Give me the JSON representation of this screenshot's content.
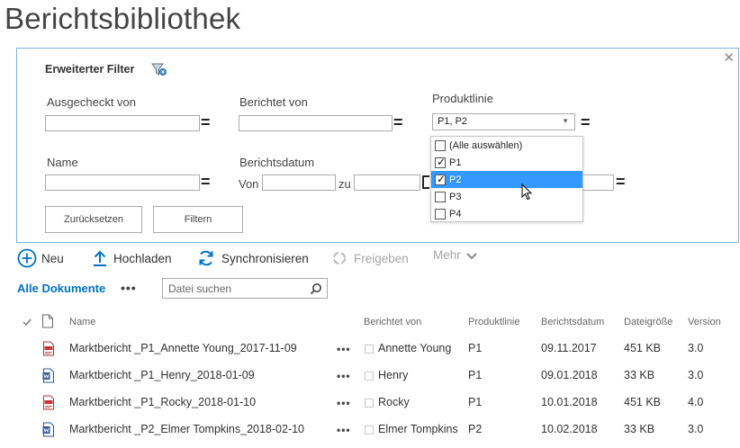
{
  "page": {
    "title": "Berichtsbibliothek"
  },
  "filter": {
    "title": "Erweiterter Filter",
    "labels": {
      "checked_out_by": "Ausgecheckt von",
      "reported_by": "Berichtet von",
      "product_line": "Produktlinie",
      "name": "Name",
      "report_date": "Berichtsdatum",
      "from": "Von",
      "to": "zu"
    },
    "values": {
      "checked_out_by": "",
      "reported_by": "",
      "name": "",
      "date_from": "",
      "date_to": ""
    },
    "equals": "=",
    "product_line_selected": "P1, P2",
    "dropdown_options": [
      {
        "label": "(Alle auswählen)",
        "checked": false,
        "highlighted": false
      },
      {
        "label": "P1",
        "checked": true,
        "highlighted": false
      },
      {
        "label": "P2",
        "checked": true,
        "highlighted": true
      },
      {
        "label": "P3",
        "checked": false,
        "highlighted": false
      },
      {
        "label": "P4",
        "checked": false,
        "highlighted": false
      }
    ],
    "reset_label": "Zurücksetzen",
    "filter_label": "Filtern",
    "close_glyph": "✕",
    "funnel_icon": "funnel-gear-icon"
  },
  "commands": {
    "new": "Neu",
    "upload": "Hochladen",
    "sync": "Synchronisieren",
    "share": "Freigeben",
    "more": "Mehr",
    "more_glyph": "⌄"
  },
  "view": {
    "name": "Alle Dokumente",
    "dots": "•••",
    "search_placeholder": "Datei suchen"
  },
  "table": {
    "columns": {
      "name": "Name",
      "reported_by": "Berichtet von",
      "product_line": "Produktlinie",
      "report_date": "Berichtsdatum",
      "file_size": "Dateigröße",
      "version": "Version"
    },
    "row_dots": "•••",
    "rows": [
      {
        "name": "Marktbericht _P1_Annette Young_2017-11-09",
        "icon": "pdf-file-icon",
        "reported_by": "Annette Young",
        "product_line": "P1",
        "report_date": "09.11.2017",
        "file_size": "451 KB",
        "version": "3.0"
      },
      {
        "name": "Marktbericht _P1_Henry_2018-01-09",
        "icon": "word-file-icon",
        "reported_by": "Henry",
        "product_line": "P1",
        "report_date": "09.01.2018",
        "file_size": "33 KB",
        "version": "3.0"
      },
      {
        "name": "Marktbericht _P1_Rocky_2018-01-10",
        "icon": "pdf-file-icon",
        "reported_by": "Rocky",
        "product_line": "P1",
        "report_date": "10.01.2018",
        "file_size": "451 KB",
        "version": "4.0"
      },
      {
        "name": "Marktbericht _P2_Elmer Tompkins_2018-02-10",
        "icon": "word-file-icon",
        "reported_by": "Elmer Tompkins",
        "product_line": "P2",
        "report_date": "10.02.2018",
        "file_size": "33 KB",
        "version": "3.0"
      }
    ]
  },
  "colors": {
    "accent": "#0072c6",
    "highlight": "#3399ff",
    "panel_border": "#7fb4d9"
  }
}
